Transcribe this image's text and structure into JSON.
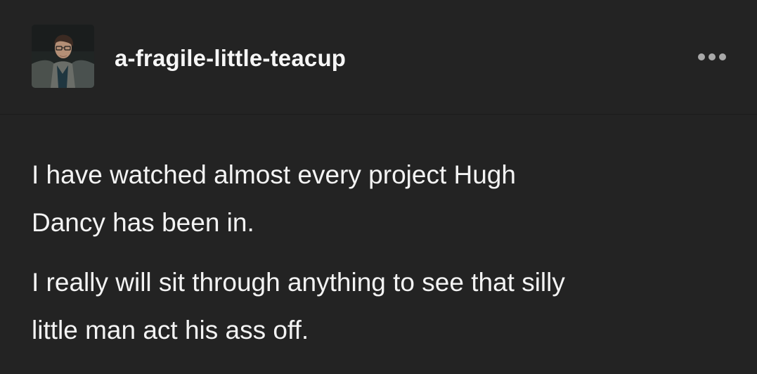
{
  "post": {
    "author": {
      "username": "a-fragile-little-teacup"
    },
    "menu": {
      "icon": "more-horizontal-icon"
    },
    "content": {
      "paragraph1": {
        "line1": "I have watched almost every project Hugh",
        "line2": "Dancy has been in."
      },
      "paragraph2": {
        "line1": "I really will sit through anything to see that silly",
        "line2": "little man act his ass off."
      }
    }
  }
}
